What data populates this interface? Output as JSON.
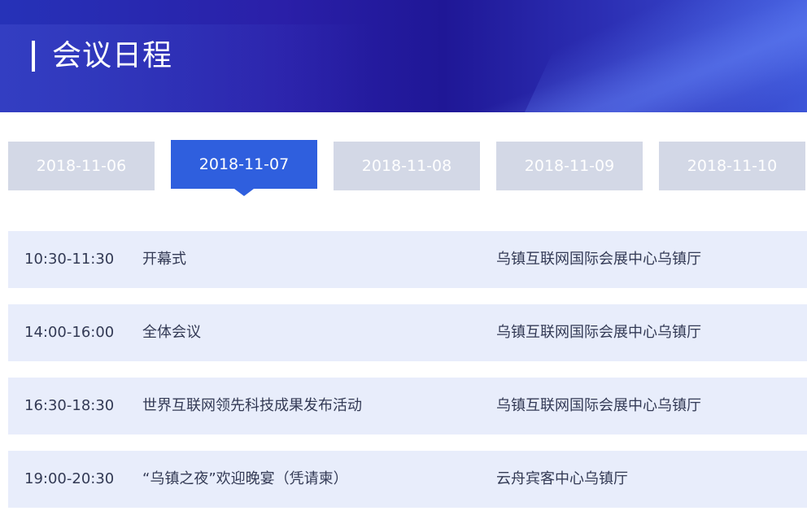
{
  "header": {
    "title": "会议日程"
  },
  "tabs": [
    {
      "label": "2018-11-06",
      "active": false
    },
    {
      "label": "2018-11-07",
      "active": true
    },
    {
      "label": "2018-11-08",
      "active": false
    },
    {
      "label": "2018-11-09",
      "active": false
    },
    {
      "label": "2018-11-10",
      "active": false
    }
  ],
  "agenda": [
    {
      "time": "10:30-11:30",
      "event": "开幕式",
      "venue": "乌镇互联网国际会展中心乌镇厅"
    },
    {
      "time": "14:00-16:00",
      "event": "全体会议",
      "venue": "乌镇互联网国际会展中心乌镇厅"
    },
    {
      "time": "16:30-18:30",
      "event": "世界互联网领先科技成果发布活动",
      "venue": "乌镇互联网国际会展中心乌镇厅"
    },
    {
      "time": "19:00-20:30",
      "event": "“乌镇之夜”欢迎晚宴（凭请柬）",
      "venue": "云舟宾客中心乌镇厅"
    }
  ],
  "colors": {
    "active_tab": "#2f5fde",
    "inactive_tab": "#d3d8e6",
    "row_background": "#e8edfb",
    "header_primary": "#2a1fa8"
  }
}
